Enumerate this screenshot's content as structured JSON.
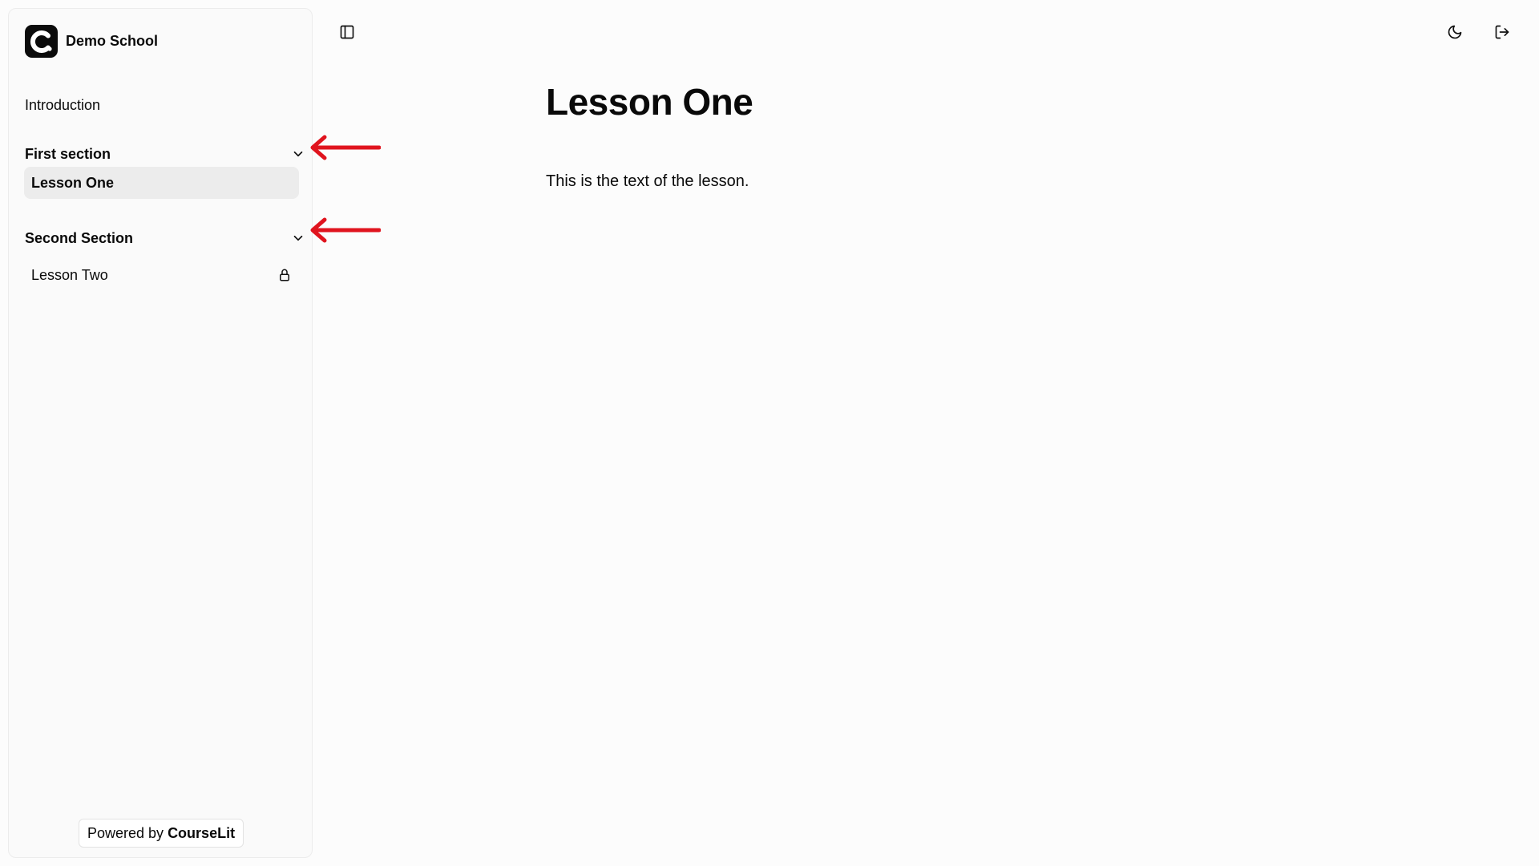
{
  "sidebar": {
    "school_name": "Demo School",
    "introduction": "Introduction",
    "sections": [
      {
        "title": "First section",
        "lessons": [
          {
            "title": "Lesson One",
            "active": true,
            "locked": false
          }
        ]
      },
      {
        "title": "Second Section",
        "lessons": [
          {
            "title": "Lesson Two",
            "active": false,
            "locked": true
          }
        ]
      }
    ],
    "powered_prefix": "Powered by",
    "powered_brand": "CourseLit"
  },
  "main": {
    "title": "Lesson One",
    "text": "This is the text of the lesson."
  },
  "icons": {
    "sidebar_toggle": "panel-left-icon",
    "theme": "moon-icon",
    "logout": "logout-icon",
    "chevron": "chevron-down-icon",
    "lock": "lock-icon"
  },
  "colors": {
    "annotation_arrow": "#e0141e",
    "active_item_bg": "#ececec"
  }
}
